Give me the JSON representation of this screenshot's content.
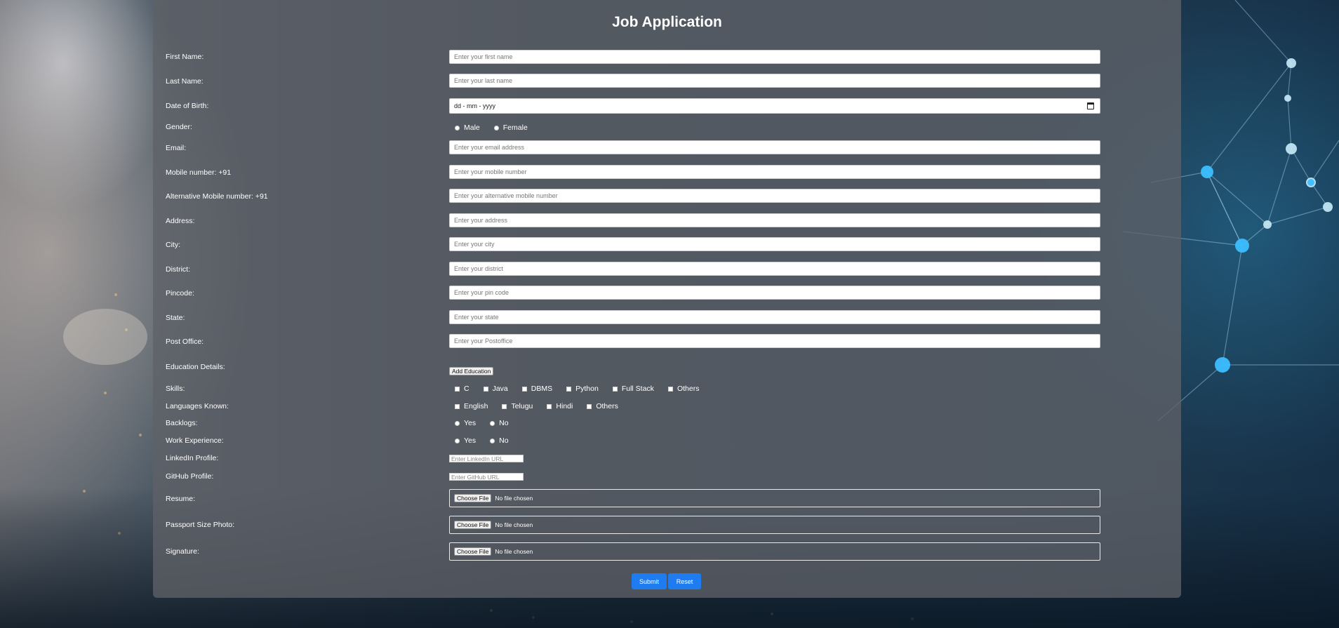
{
  "form": {
    "title": "Job Application",
    "fields": {
      "first_name": {
        "label": "First Name:",
        "placeholder": "Enter your first name"
      },
      "last_name": {
        "label": "Last Name:",
        "placeholder": "Enter your last name"
      },
      "dob": {
        "label": "Date of Birth:",
        "placeholder": "dd - mm - yyyy"
      },
      "gender": {
        "label": "Gender:",
        "options": [
          "Male",
          "Female"
        ]
      },
      "email": {
        "label": "Email:",
        "placeholder": "Enter your email address"
      },
      "mobile": {
        "label": "Mobile number: +91",
        "placeholder": "Enter your mobile number"
      },
      "alt_mobile": {
        "label": "Alternative Mobile number: +91",
        "placeholder": "Enter your alternative mobile number"
      },
      "address": {
        "label": "Address:",
        "placeholder": "Enter your address"
      },
      "city": {
        "label": "City:",
        "placeholder": "Enter your city"
      },
      "district": {
        "label": "District:",
        "placeholder": "Enter your district"
      },
      "pincode": {
        "label": "Pincode:",
        "placeholder": "Enter your pin code"
      },
      "state": {
        "label": "State:",
        "placeholder": "Enter your state"
      },
      "post_office": {
        "label": "Post Office:",
        "placeholder": "Enter your Postoffice"
      },
      "education": {
        "label": "Education Details:",
        "button": "Add Education"
      },
      "skills": {
        "label": "Skills:",
        "options": [
          "C",
          "Java",
          "DBMS",
          "Python",
          "Full Stack",
          "Others"
        ]
      },
      "languages": {
        "label": "Languages Known:",
        "options": [
          "English",
          "Telugu",
          "Hindi",
          "Others"
        ]
      },
      "backlogs": {
        "label": "Backlogs:",
        "options": [
          "Yes",
          "No"
        ]
      },
      "work_experience": {
        "label": "Work Experience:",
        "options": [
          "Yes",
          "No"
        ]
      },
      "linkedin": {
        "label": "LinkedIn Profile:",
        "placeholder": "Enter LinkedIn URL"
      },
      "github": {
        "label": "GitHub Profile:",
        "placeholder": "Enter GitHub URL"
      },
      "resume": {
        "label": "Resume:",
        "button": "Choose File",
        "status": "No file chosen"
      },
      "photo": {
        "label": "Passport Size Photo:",
        "button": "Choose File",
        "status": "No file chosen"
      },
      "signature": {
        "label": "Signature:",
        "button": "Choose File",
        "status": "No file chosen"
      }
    },
    "actions": {
      "submit": "Submit",
      "reset": "Reset"
    },
    "colors": {
      "accent": "#1e7bf0",
      "card": "rgba(95,98,104,0.78)"
    }
  }
}
